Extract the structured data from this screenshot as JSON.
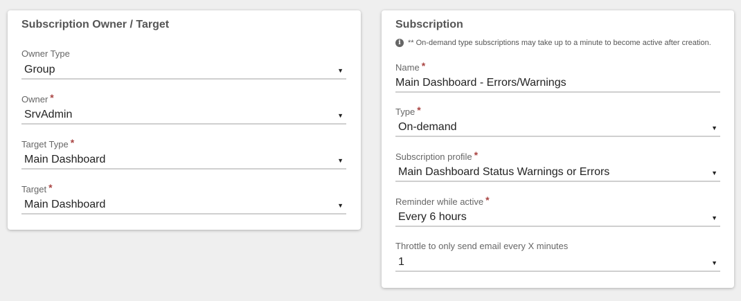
{
  "owner_card": {
    "title": "Subscription Owner / Target",
    "fields": [
      {
        "label": "Owner Type",
        "value": "Group",
        "required": false
      },
      {
        "label": "Owner",
        "value": "SrvAdmin",
        "required": true
      },
      {
        "label": "Target Type",
        "value": "Main Dashboard",
        "required": true
      },
      {
        "label": "Target",
        "value": "Main Dashboard",
        "required": true
      }
    ]
  },
  "subscription_card": {
    "title": "Subscription",
    "note": "** On-demand type subscriptions may take up to a minute to become active after creation.",
    "name_field": {
      "label": "Name",
      "value": "Main Dashboard - Errors/Warnings",
      "required": true
    },
    "fields": [
      {
        "label": "Type",
        "value": "On-demand",
        "required": true
      },
      {
        "label": "Subscription profile",
        "value": "Main Dashboard Status Warnings or Errors",
        "required": true
      },
      {
        "label": "Reminder while active",
        "value": "Every 6 hours",
        "required": true
      },
      {
        "label": "Throttle to only send email every X minutes",
        "value": "1",
        "required": false
      }
    ]
  },
  "symbols": {
    "required_marker": "*",
    "dropdown_caret": "▼",
    "info_icon": "i"
  },
  "colors": {
    "required": "#a94442",
    "background": "#efefef",
    "card": "#ffffff"
  }
}
